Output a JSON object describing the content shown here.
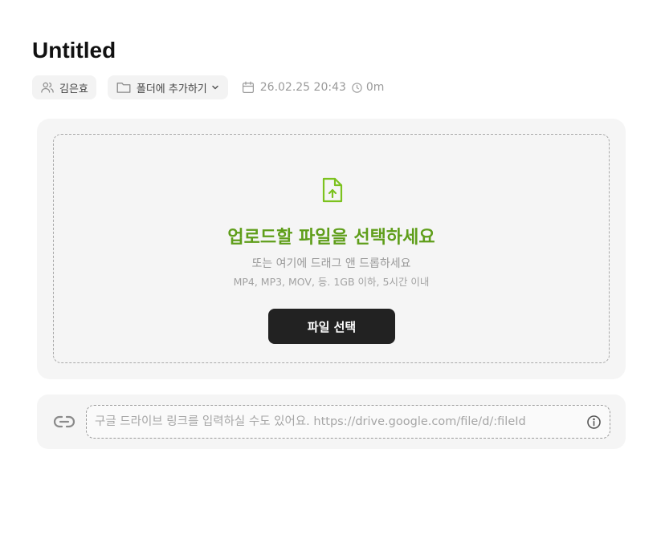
{
  "page": {
    "title": "Untitled"
  },
  "meta": {
    "owner_label": "김은효",
    "folder_label": "폴더에 추가하기",
    "date": "26.02.25 20:43",
    "duration": "0m"
  },
  "upload": {
    "title": "업로드할 파일을 선택하세요",
    "subtitle": "또는 여기에 드래그 앤 드롭하세요",
    "hint": "MP4, MP3, MOV, 등. 1GB 이하, 5시간 이내",
    "button_label": "파일 선택"
  },
  "link": {
    "placeholder": "구글 드라이브 링크를 입력하실 수도 있어요. https://drive.google.com/file/d/:fileId",
    "value": ""
  },
  "colors": {
    "accent_green": "#5f9e1a",
    "icon_green": "#7cc21e",
    "button_dark": "#222222",
    "card_bg": "#f5f5f5"
  },
  "icons": {
    "owner": "users-icon",
    "folder": "folder-icon",
    "chevron": "chevron-down-icon",
    "calendar": "calendar-icon",
    "clock": "clock-icon",
    "file_upload": "file-upload-icon",
    "link": "link-icon",
    "info": "info-icon"
  }
}
